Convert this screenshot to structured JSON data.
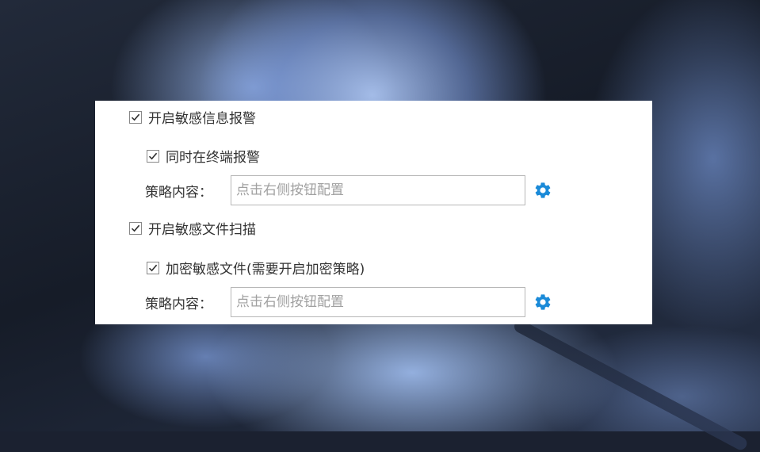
{
  "alert_section": {
    "enable_label": "开启敏感信息报警",
    "enable_checked": true,
    "terminal_label": "同时在终端报警",
    "terminal_checked": true,
    "policy_label": "策略内容：",
    "policy_placeholder": "点击右侧按钮配置",
    "policy_value": "",
    "config_icon": "gear-icon"
  },
  "scan_section": {
    "enable_label": "开启敏感文件扫描",
    "enable_checked": true,
    "encrypt_label": "加密敏感文件(需要开启加密策略)",
    "encrypt_checked": true,
    "policy_label": "策略内容：",
    "policy_placeholder": "点击右侧按钮配置",
    "policy_value": "",
    "config_icon": "gear-icon"
  },
  "colors": {
    "gear": "#1a8ad8",
    "panel_bg": "#ffffff",
    "text": "#333333",
    "placeholder": "#a0a0a0"
  }
}
